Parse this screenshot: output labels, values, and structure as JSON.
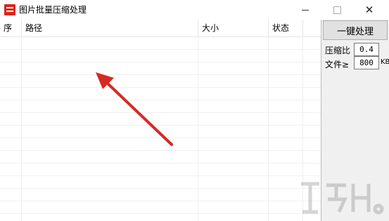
{
  "window": {
    "title": "图片批量压缩处理",
    "minimize_icon": "minimize-icon",
    "maximize_icon": "maximize-icon",
    "close_icon": "close-icon"
  },
  "list": {
    "columns": [
      "序",
      "路径",
      "大小",
      "状态"
    ],
    "rows": []
  },
  "panel": {
    "process_label": "一键处理",
    "ratio_label": "压缩比",
    "ratio_value": "0.4",
    "size_label": "文件≥",
    "size_value": "800",
    "size_unit": "KB"
  },
  "colors": {
    "arrow": "#d42a22",
    "panel_bg": "#f0f0f0",
    "button_bg": "#e1e1e1"
  }
}
